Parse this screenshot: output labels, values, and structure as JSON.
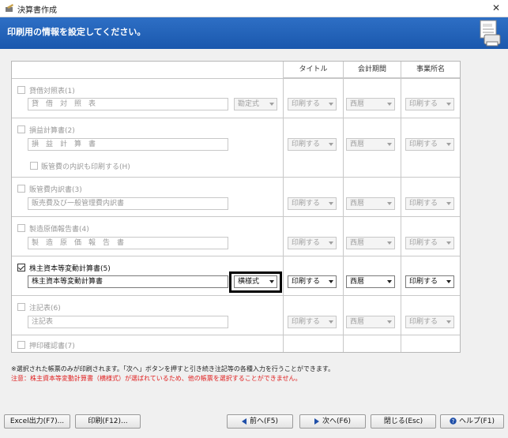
{
  "window": {
    "title": "決算書作成",
    "close_label": "✕"
  },
  "header": {
    "text": "印刷用の情報を設定してください。"
  },
  "columns": [
    "タイトル",
    "会計期間",
    "事業所名"
  ],
  "reports": [
    {
      "id": "balance-sheet",
      "checked": false,
      "label": "貸借対照表(1)",
      "name_value": "貸　借　対　照　表",
      "format": "勘定式",
      "title_opt": "印刷する",
      "period_opt": "西暦",
      "office_opt": "印刷する"
    },
    {
      "id": "income-statement",
      "checked": false,
      "label": "損益計算書(2)",
      "name_value": "損　益　計　算　書",
      "sub_label": "販管費の内訳も印刷する(H)",
      "title_opt": "印刷する",
      "period_opt": "西暦",
      "office_opt": "印刷する"
    },
    {
      "id": "sga-statement",
      "checked": false,
      "label": "販管費内訳書(3)",
      "name_value": "販売費及び一般管理費内訳書",
      "title_opt": "印刷する",
      "period_opt": "西暦",
      "office_opt": "印刷する"
    },
    {
      "id": "manufacturing-cost",
      "checked": false,
      "label": "製造原価報告書(4)",
      "name_value": "製　造　原　価　報　告　書",
      "title_opt": "印刷する",
      "period_opt": "西暦",
      "office_opt": "印刷する"
    },
    {
      "id": "equity-changes",
      "checked": true,
      "label": "株主資本等変動計算書(5)",
      "name_value": "株主資本等変動計算書",
      "format": "横様式",
      "title_opt": "印刷する",
      "period_opt": "西暦",
      "office_opt": "印刷する"
    },
    {
      "id": "notes",
      "checked": false,
      "label": "注記表(6)",
      "name_value": "注記表",
      "title_opt": "印刷する",
      "period_opt": "西暦",
      "office_opt": "印刷する"
    },
    {
      "id": "seal-confirmation",
      "checked": false,
      "label": "押印確認書(7)"
    }
  ],
  "notes": {
    "info": "※選択された帳票のみが印刷されます。「次へ」ボタンを押すと引き続き注記等の各種入力を行うことができます。",
    "warning": "注意：株主資本等変動計算書（横様式）が選ばれているため、他の帳票を選択することができません。"
  },
  "buttons": {
    "excel": "Excel出力(F7)...",
    "print": "印刷(F12)...",
    "prev": "前へ(F5)",
    "next": "次へ(F6)",
    "close": "閉じる(Esc)",
    "help": "ヘルプ(F1)"
  },
  "colors": {
    "header_blue": "#1a58ad",
    "warning_red": "#e02020",
    "button_icon_blue": "#1f4fa8"
  }
}
